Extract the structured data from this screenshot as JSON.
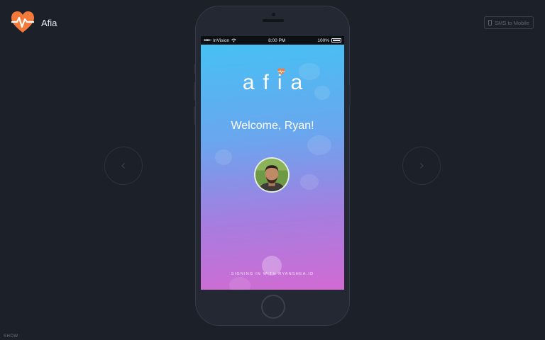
{
  "app": {
    "name": "Afia",
    "brand_color": "#f47a3c"
  },
  "toolbar": {
    "sms_label": "SMS to Mobile",
    "sms_icon": "mobile-phone-icon"
  },
  "navigation": {
    "prev_icon": "chevron-left-icon",
    "next_icon": "chevron-right-icon"
  },
  "footer": {
    "show_label": "SHOW"
  },
  "device": {
    "status_bar": {
      "carrier": "InVision",
      "time": "8:00 PM",
      "battery": "100%"
    },
    "screen": {
      "logo_text": "afia",
      "welcome": "Welcome, Ryan!",
      "signing_in": "SIGNING IN WITH RYANSHEA.ID",
      "gradient": [
        "#43c3f4",
        "#6aa6ee",
        "#a47ee0",
        "#d26ad2"
      ]
    }
  }
}
